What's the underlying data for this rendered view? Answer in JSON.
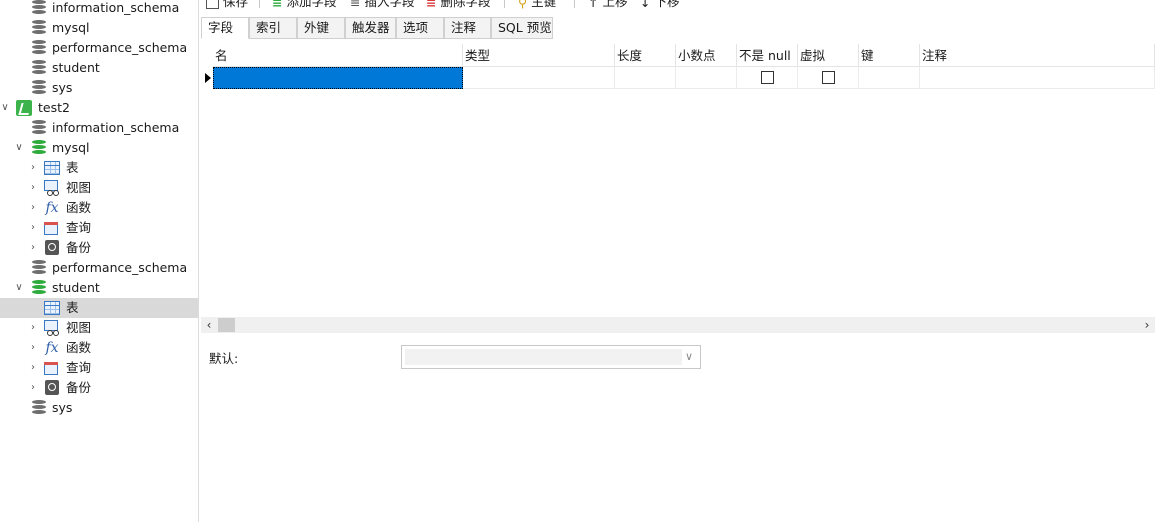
{
  "toolbar": {
    "save": "保存",
    "add_field": "添加字段",
    "insert_field": "插入字段",
    "delete_field": "删除字段",
    "primary_key": "主键",
    "move_up": "上移",
    "move_down": "下移"
  },
  "tabs": {
    "fields": "字段",
    "indexes": "索引",
    "foreign_keys": "外键",
    "triggers": "触发器",
    "options": "选项",
    "comment": "注释",
    "sql_preview": "SQL 预览"
  },
  "grid": {
    "headers": {
      "name": "名",
      "type": "类型",
      "length": "长度",
      "decimals": "小数点",
      "not_null": "不是 null",
      "virtual": "虚拟",
      "key": "键",
      "comment": "注释"
    }
  },
  "default": {
    "label": "默认:"
  },
  "tree": {
    "r0": "information_schema",
    "r1": "mysql",
    "r2": "performance_schema",
    "r3": "student",
    "r4": "sys",
    "r5": "test2",
    "r6": "information_schema",
    "r7": "mysql",
    "r8": "表",
    "r9": "视图",
    "r10": "函数",
    "r11": "查询",
    "r12": "备份",
    "r13": "performance_schema",
    "r14": "student",
    "r15": "表",
    "r16": "视图",
    "r17": "函数",
    "r18": "查询",
    "r19": "备份",
    "r20": "sys"
  },
  "icons": {
    "database": "database-icon",
    "connection": "mysql-connection-icon",
    "table": "table-icon",
    "view": "view-icon",
    "function": "function-icon",
    "query": "query-icon",
    "backup": "backup-icon"
  },
  "colors": {
    "selection": "#0078d7",
    "db_open": "#2faa3c",
    "db_closed": "#6e6e6e",
    "tree_selected": "#d9d9d9"
  }
}
